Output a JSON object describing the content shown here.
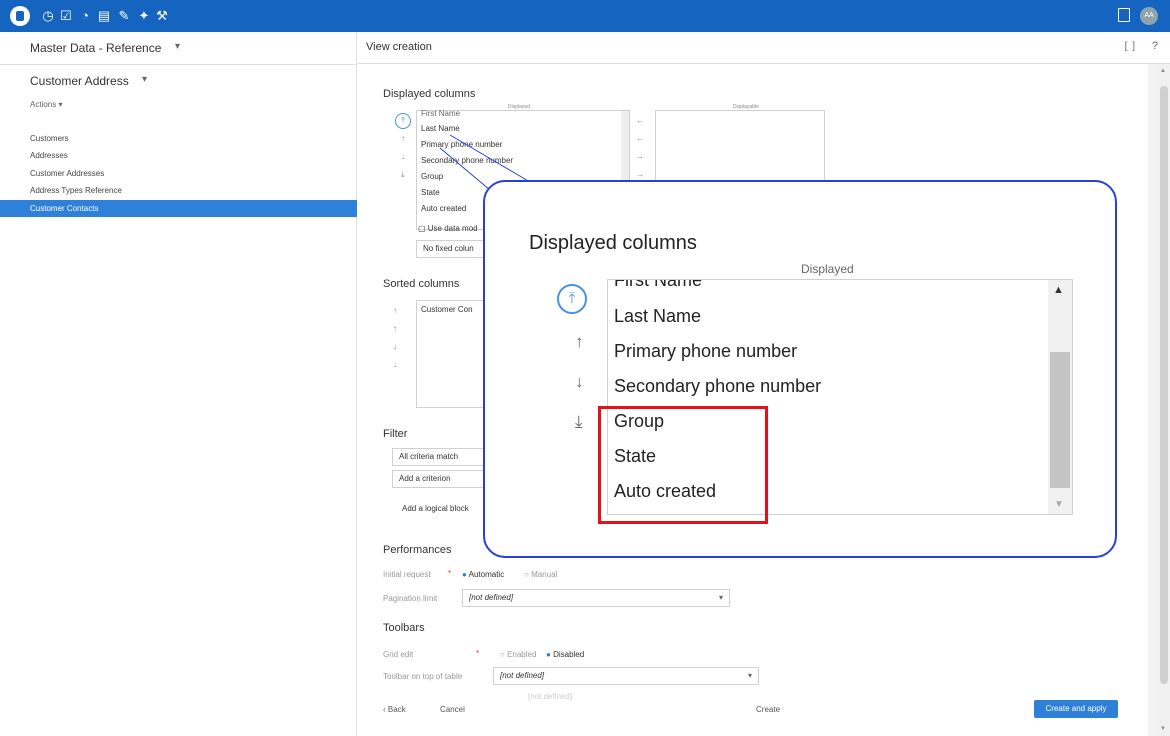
{
  "topbar": {
    "icons": [
      "home-icon",
      "clock-icon",
      "check-doc-icon",
      "gauge-icon",
      "doc-icon",
      "edit-doc-icon",
      "pin-icon",
      "wrench-icon"
    ],
    "avatar": "AA",
    "colors": {
      "bar": "#1565c0",
      "accent": "#2f80d8",
      "callout_border": "#2a3fd8",
      "highlight": "#e0131a"
    }
  },
  "sidebar": {
    "title": "Master Data - Reference",
    "subtitle": "Customer Address",
    "actions": "Actions ▾",
    "items": [
      {
        "label": "Customers"
      },
      {
        "label": "Addresses"
      },
      {
        "label": "Customer Addresses"
      },
      {
        "label": "Address Types Reference"
      },
      {
        "label": "Customer Contacts",
        "active": true
      }
    ]
  },
  "header": {
    "title": "View creation",
    "expand": "[ ]",
    "help": "?"
  },
  "form": {
    "displayed_columns": {
      "title": "Displayed columns",
      "displayed_label": "Displayed",
      "displayable_label": "Displayable",
      "items": [
        "First Name",
        "Last Name",
        "Primary phone number",
        "Secondary phone number",
        "Group",
        "State",
        "Auto created"
      ],
      "use_data_model": "Use data mod",
      "fixed_columns": "No fixed colun"
    },
    "sorted_columns": {
      "title": "Sorted columns",
      "item": "Customer Con"
    },
    "filter": {
      "title": "Filter",
      "all_criteria": "All criteria match",
      "add_criterion": "Add a criterion",
      "add_block": "Add a logical block"
    },
    "performances": {
      "title": "Performances",
      "initial_request_label": "Initial request",
      "initial_request_required": "*",
      "automatic": "Automatic",
      "manual": "Manual",
      "pagination_label": "Pagination limit",
      "pagination_value": "[not defined]"
    },
    "toolbars": {
      "title": "Toolbars",
      "grid_edit_label": "Grid edit",
      "grid_edit_required": "*",
      "enabled": "Enabled",
      "disabled": "Disabled",
      "toolbar_top_label": "Toolbar on top of table",
      "toolbar_top_value": "[not defined]",
      "toolbar_next_value": "[not defined]"
    },
    "footer": {
      "back": "‹  Back",
      "cancel": "Cancel",
      "create": "Create",
      "create_apply": "Create and apply"
    }
  },
  "callout": {
    "title": "Displayed columns",
    "label": "Displayed",
    "items": [
      "First Name",
      "Last Name",
      "Primary phone number",
      "Secondary phone number",
      "Group",
      "State",
      "Auto created"
    ],
    "highlighted": [
      "Group",
      "State",
      "Auto created"
    ]
  }
}
